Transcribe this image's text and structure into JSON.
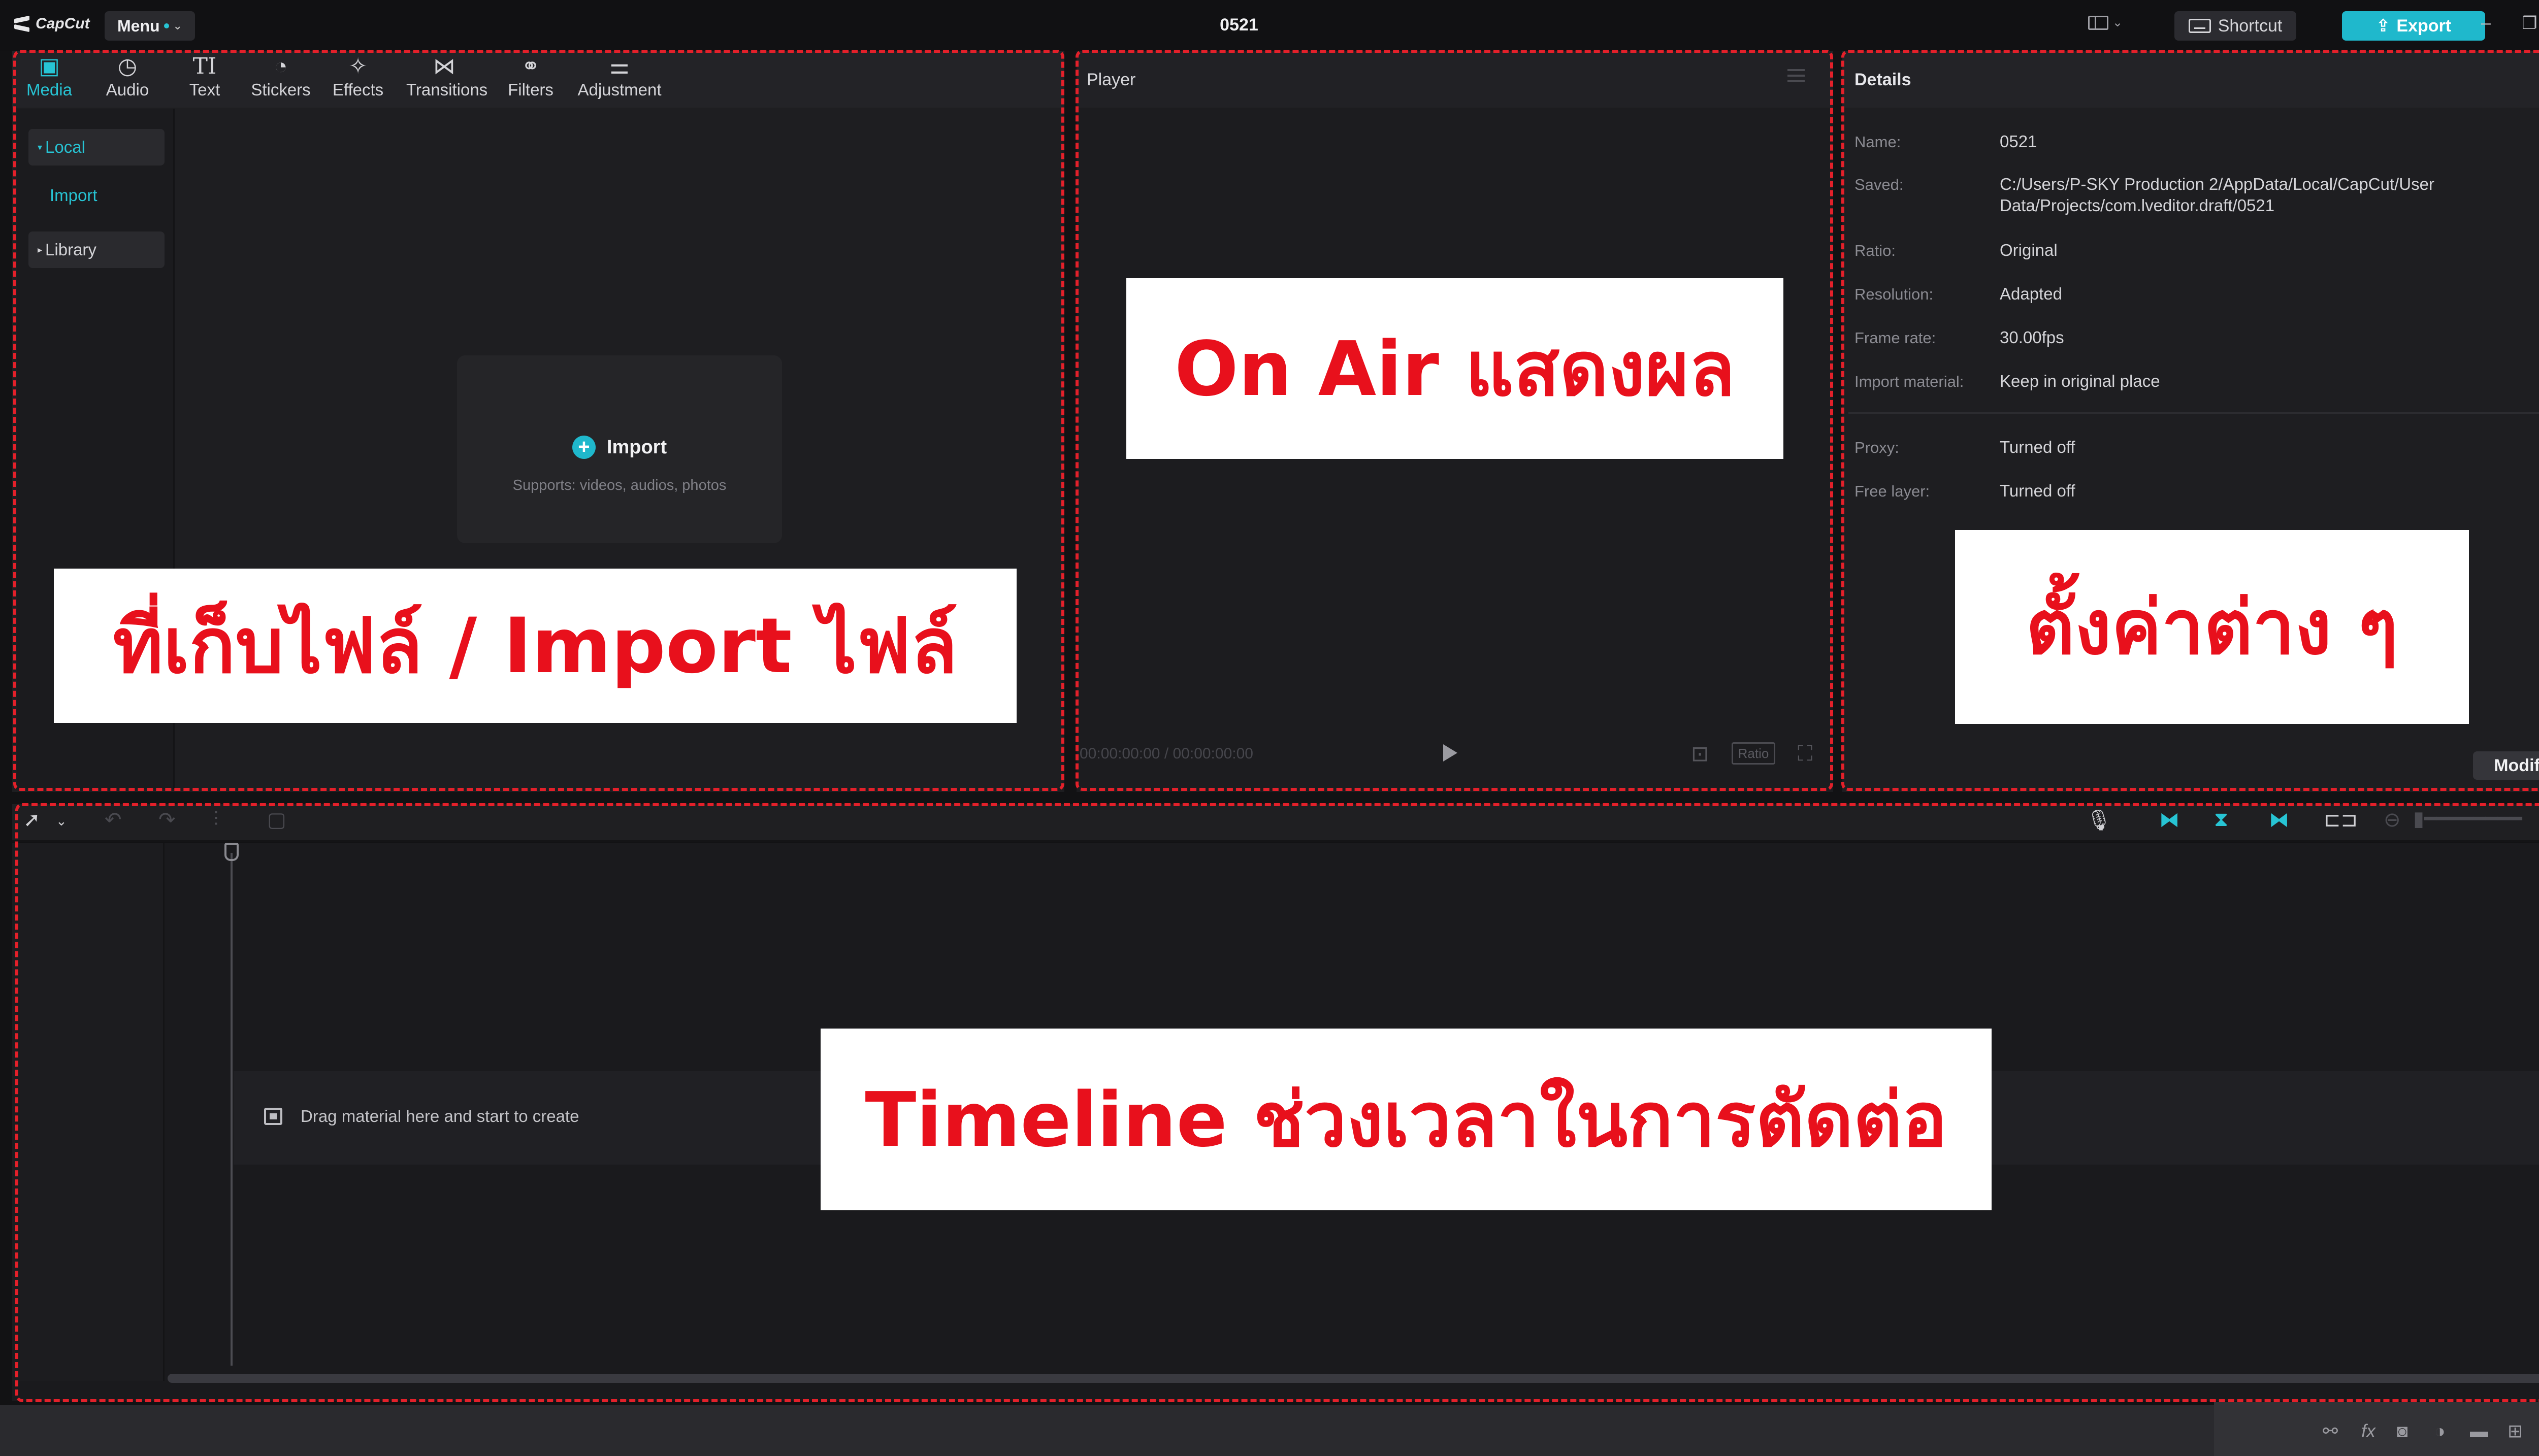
{
  "app": {
    "logo_text": "CapCut",
    "menu_label": "Menu",
    "project_title": "0521",
    "shortcut_label": "Shortcut",
    "export_label": "Export"
  },
  "media_tabs": [
    {
      "label": "Media",
      "icon": "media-icon",
      "active": true
    },
    {
      "label": "Audio",
      "icon": "audio-icon",
      "active": false
    },
    {
      "label": "Text",
      "icon": "text-icon",
      "active": false
    },
    {
      "label": "Stickers",
      "icon": "stickers-icon",
      "active": false
    },
    {
      "label": "Effects",
      "icon": "effects-icon",
      "active": false
    },
    {
      "label": "Transitions",
      "icon": "transitions-icon",
      "active": false
    },
    {
      "label": "Filters",
      "icon": "filters-icon",
      "active": false
    },
    {
      "label": "Adjustment",
      "icon": "adjustment-icon",
      "active": false
    }
  ],
  "media_sidebar": {
    "local": "Local",
    "import": "Import",
    "library": "Library"
  },
  "import_card": {
    "title": "Import",
    "subtitle": "Supports: videos, audios, photos"
  },
  "player": {
    "title": "Player",
    "timecode": "00:00:00:00 / 00:00:00:00",
    "ratio_label": "Ratio"
  },
  "details": {
    "title": "Details",
    "rows": [
      {
        "label": "Name:",
        "value": "0521"
      },
      {
        "label": "Saved:",
        "value": "C:/Users/P-SKY Production 2/AppData/Local/CapCut/User Data/Projects/com.lveditor.draft/0521"
      },
      {
        "label": "Ratio:",
        "value": "Original"
      },
      {
        "label": "Resolution:",
        "value": "Adapted"
      },
      {
        "label": "Frame rate:",
        "value": "30.00fps"
      },
      {
        "label": "Import material:",
        "value": "Keep in original place"
      },
      {
        "label": "Proxy:",
        "value": "Turned off"
      },
      {
        "label": "Free layer:",
        "value": "Turned off"
      }
    ],
    "modify_label": "Modify"
  },
  "timeline": {
    "drag_hint": "Drag material here and start to create"
  },
  "annotations": {
    "media": "ที่เก็บไฟล์ / Import ไฟล์",
    "player": "On Air แสดงผล",
    "details": "ตั้งค่าต่าง ๆ",
    "timeline": "Timeline ช่วงเวลาในการตัดต่อ"
  },
  "colors": {
    "accent": "#1fb8cc",
    "annotation_red": "#e3202a",
    "panel_bg": "#1e1e21"
  }
}
